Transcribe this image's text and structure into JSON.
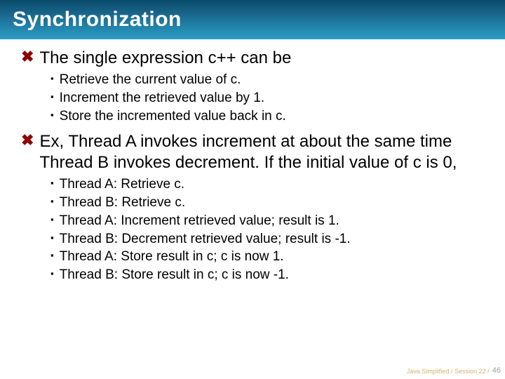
{
  "title": "Synchronization",
  "main": [
    {
      "text": "The single expression c++ can be",
      "sub": [
        "Retrieve the current value of c.",
        "Increment the retrieved value by 1.",
        "Store the incremented value back in c."
      ]
    },
    {
      "text": "Ex, Thread A invokes increment at about the same time Thread B invokes decrement. If the initial value of c is 0,",
      "sub": [
        "Thread A: Retrieve c.",
        "Thread B: Retrieve c.",
        "Thread A: Increment retrieved value; result is 1.",
        "Thread B: Decrement retrieved value; result is -1.",
        "Thread A: Store result in c; c is now 1.",
        "Thread B: Store result in c; c is now -1."
      ]
    }
  ],
  "footer": "Java Simplified / Session 22 / 46 ",
  "page_number": "46"
}
